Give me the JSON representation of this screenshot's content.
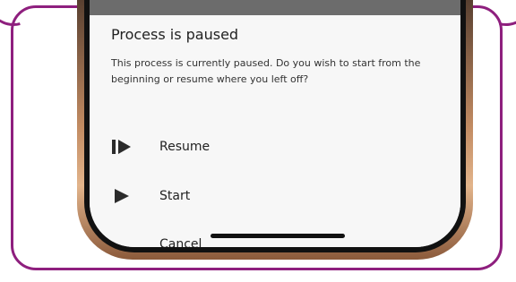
{
  "dialog": {
    "title": "Process is paused",
    "message": "This process is currently paused. Do you wish to start from the beginning or resume where you left off?"
  },
  "options": [
    {
      "label": "Resume",
      "icon": "resume-icon"
    },
    {
      "label": "Start",
      "icon": "play-icon"
    },
    {
      "label": "Cancel"
    }
  ],
  "colors": {
    "callout_border": "#8e1f7e",
    "dialog_bg": "#f7f7f7",
    "status_strip": "#6c6c6c"
  }
}
